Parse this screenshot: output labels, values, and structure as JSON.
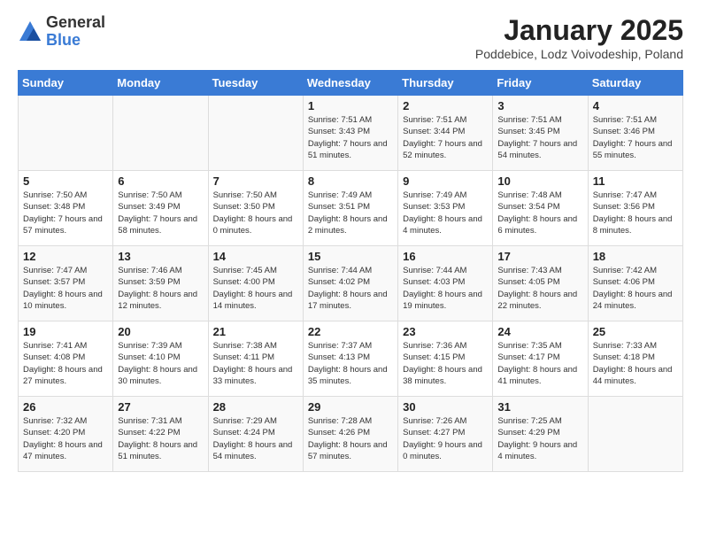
{
  "logo": {
    "general": "General",
    "blue": "Blue"
  },
  "title": "January 2025",
  "subtitle": "Poddebice, Lodz Voivodeship, Poland",
  "days": [
    "Sunday",
    "Monday",
    "Tuesday",
    "Wednesday",
    "Thursday",
    "Friday",
    "Saturday"
  ],
  "weeks": [
    [
      {
        "day": "",
        "content": ""
      },
      {
        "day": "",
        "content": ""
      },
      {
        "day": "",
        "content": ""
      },
      {
        "day": "1",
        "content": "Sunrise: 7:51 AM\nSunset: 3:43 PM\nDaylight: 7 hours and 51 minutes."
      },
      {
        "day": "2",
        "content": "Sunrise: 7:51 AM\nSunset: 3:44 PM\nDaylight: 7 hours and 52 minutes."
      },
      {
        "day": "3",
        "content": "Sunrise: 7:51 AM\nSunset: 3:45 PM\nDaylight: 7 hours and 54 minutes."
      },
      {
        "day": "4",
        "content": "Sunrise: 7:51 AM\nSunset: 3:46 PM\nDaylight: 7 hours and 55 minutes."
      }
    ],
    [
      {
        "day": "5",
        "content": "Sunrise: 7:50 AM\nSunset: 3:48 PM\nDaylight: 7 hours and 57 minutes."
      },
      {
        "day": "6",
        "content": "Sunrise: 7:50 AM\nSunset: 3:49 PM\nDaylight: 7 hours and 58 minutes."
      },
      {
        "day": "7",
        "content": "Sunrise: 7:50 AM\nSunset: 3:50 PM\nDaylight: 8 hours and 0 minutes."
      },
      {
        "day": "8",
        "content": "Sunrise: 7:49 AM\nSunset: 3:51 PM\nDaylight: 8 hours and 2 minutes."
      },
      {
        "day": "9",
        "content": "Sunrise: 7:49 AM\nSunset: 3:53 PM\nDaylight: 8 hours and 4 minutes."
      },
      {
        "day": "10",
        "content": "Sunrise: 7:48 AM\nSunset: 3:54 PM\nDaylight: 8 hours and 6 minutes."
      },
      {
        "day": "11",
        "content": "Sunrise: 7:47 AM\nSunset: 3:56 PM\nDaylight: 8 hours and 8 minutes."
      }
    ],
    [
      {
        "day": "12",
        "content": "Sunrise: 7:47 AM\nSunset: 3:57 PM\nDaylight: 8 hours and 10 minutes."
      },
      {
        "day": "13",
        "content": "Sunrise: 7:46 AM\nSunset: 3:59 PM\nDaylight: 8 hours and 12 minutes."
      },
      {
        "day": "14",
        "content": "Sunrise: 7:45 AM\nSunset: 4:00 PM\nDaylight: 8 hours and 14 minutes."
      },
      {
        "day": "15",
        "content": "Sunrise: 7:44 AM\nSunset: 4:02 PM\nDaylight: 8 hours and 17 minutes."
      },
      {
        "day": "16",
        "content": "Sunrise: 7:44 AM\nSunset: 4:03 PM\nDaylight: 8 hours and 19 minutes."
      },
      {
        "day": "17",
        "content": "Sunrise: 7:43 AM\nSunset: 4:05 PM\nDaylight: 8 hours and 22 minutes."
      },
      {
        "day": "18",
        "content": "Sunrise: 7:42 AM\nSunset: 4:06 PM\nDaylight: 8 hours and 24 minutes."
      }
    ],
    [
      {
        "day": "19",
        "content": "Sunrise: 7:41 AM\nSunset: 4:08 PM\nDaylight: 8 hours and 27 minutes."
      },
      {
        "day": "20",
        "content": "Sunrise: 7:39 AM\nSunset: 4:10 PM\nDaylight: 8 hours and 30 minutes."
      },
      {
        "day": "21",
        "content": "Sunrise: 7:38 AM\nSunset: 4:11 PM\nDaylight: 8 hours and 33 minutes."
      },
      {
        "day": "22",
        "content": "Sunrise: 7:37 AM\nSunset: 4:13 PM\nDaylight: 8 hours and 35 minutes."
      },
      {
        "day": "23",
        "content": "Sunrise: 7:36 AM\nSunset: 4:15 PM\nDaylight: 8 hours and 38 minutes."
      },
      {
        "day": "24",
        "content": "Sunrise: 7:35 AM\nSunset: 4:17 PM\nDaylight: 8 hours and 41 minutes."
      },
      {
        "day": "25",
        "content": "Sunrise: 7:33 AM\nSunset: 4:18 PM\nDaylight: 8 hours and 44 minutes."
      }
    ],
    [
      {
        "day": "26",
        "content": "Sunrise: 7:32 AM\nSunset: 4:20 PM\nDaylight: 8 hours and 47 minutes."
      },
      {
        "day": "27",
        "content": "Sunrise: 7:31 AM\nSunset: 4:22 PM\nDaylight: 8 hours and 51 minutes."
      },
      {
        "day": "28",
        "content": "Sunrise: 7:29 AM\nSunset: 4:24 PM\nDaylight: 8 hours and 54 minutes."
      },
      {
        "day": "29",
        "content": "Sunrise: 7:28 AM\nSunset: 4:26 PM\nDaylight: 8 hours and 57 minutes."
      },
      {
        "day": "30",
        "content": "Sunrise: 7:26 AM\nSunset: 4:27 PM\nDaylight: 9 hours and 0 minutes."
      },
      {
        "day": "31",
        "content": "Sunrise: 7:25 AM\nSunset: 4:29 PM\nDaylight: 9 hours and 4 minutes."
      },
      {
        "day": "",
        "content": ""
      }
    ]
  ]
}
